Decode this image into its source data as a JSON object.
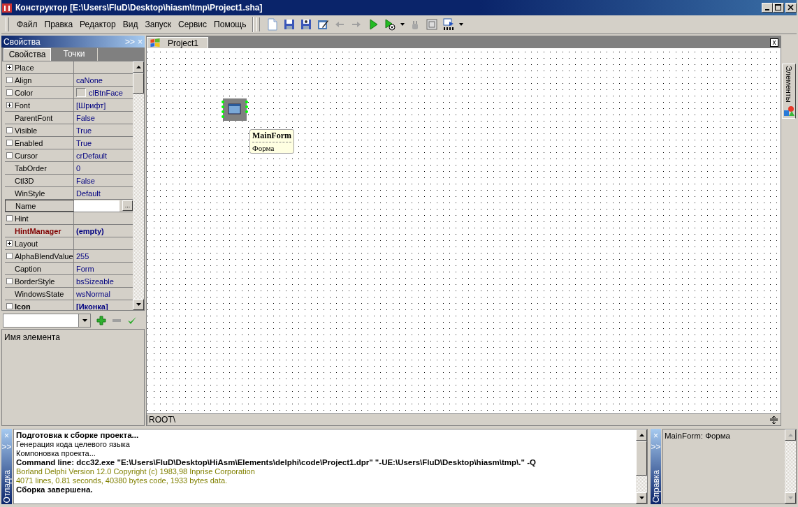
{
  "window": {
    "title": "Конструктор [E:\\Users\\FluD\\Desktop\\hiasm\\tmp\\Project1.sha]"
  },
  "menu": [
    "Файл",
    "Правка",
    "Редактор",
    "Вид",
    "Запуск",
    "Сервис",
    "Помощь"
  ],
  "toolbar": [
    {
      "kind": "new"
    },
    {
      "kind": "save"
    },
    {
      "kind": "saveas"
    },
    {
      "kind": "edit"
    },
    {
      "kind": "back",
      "disabled": true
    },
    {
      "kind": "forward",
      "disabled": true
    },
    {
      "kind": "run",
      "disabled": false
    },
    {
      "kind": "runstop",
      "disabled": false
    },
    {
      "kind": "caret"
    },
    {
      "kind": "plugin",
      "disabled": true
    },
    {
      "kind": "frame"
    },
    {
      "kind": "compile"
    },
    {
      "kind": "caret"
    }
  ],
  "properties_panel": {
    "title": "Свойства",
    "expand": ">>",
    "close": "×",
    "tabs": [
      {
        "label": "Свойства",
        "selected": true
      },
      {
        "label": "Точки",
        "selected": false
      }
    ],
    "rows": [
      {
        "name": "Place",
        "kind": "group",
        "changed": false,
        "selected": false
      },
      {
        "name": "Align",
        "value": "caNone",
        "kind": "check",
        "changed": false,
        "selected": false
      },
      {
        "name": "Color",
        "value": "clBtnFace",
        "kind": "color",
        "changed": false,
        "selected": false
      },
      {
        "name": "Font",
        "value": "[Шрифт]",
        "kind": "group",
        "changed": false,
        "selected": false
      },
      {
        "name": "ParentFont",
        "value": "False",
        "kind": "plain",
        "changed": false,
        "selected": false
      },
      {
        "name": "Visible",
        "value": "True",
        "kind": "check",
        "changed": false,
        "selected": false
      },
      {
        "name": "Enabled",
        "value": "True",
        "kind": "check",
        "changed": false,
        "selected": false
      },
      {
        "name": "Cursor",
        "value": "crDefault",
        "kind": "check",
        "changed": false,
        "selected": false
      },
      {
        "name": "TabOrder",
        "value": "0",
        "kind": "plain",
        "changed": false,
        "selected": false
      },
      {
        "name": "Ctl3D",
        "value": "False",
        "kind": "plain",
        "changed": false,
        "selected": false
      },
      {
        "name": "WinStyle",
        "value": "Default",
        "kind": "plain",
        "changed": false,
        "selected": false
      },
      {
        "name": "Name",
        "kind": "plain",
        "changed": false,
        "selected": true,
        "button": "..."
      },
      {
        "name": "Hint",
        "kind": "check",
        "changed": false,
        "selected": false
      },
      {
        "name": "HintManager",
        "value": "(empty)",
        "kind": "link",
        "changed": true,
        "selected": false
      },
      {
        "name": "Layout",
        "kind": "group",
        "changed": false,
        "selected": false
      },
      {
        "name": "AlphaBlendValue",
        "value": "255",
        "kind": "check",
        "changed": false,
        "selected": false
      },
      {
        "name": "Caption",
        "value": "Form",
        "kind": "plain",
        "changed": false,
        "selected": false
      },
      {
        "name": "BorderStyle",
        "value": "bsSizeable",
        "kind": "check",
        "changed": false,
        "selected": false
      },
      {
        "name": "WindowsState",
        "value": "wsNormal",
        "kind": "plain",
        "changed": false,
        "selected": false
      },
      {
        "name": "Icon",
        "value": "[Иконка]",
        "kind": "check",
        "changed": true,
        "selected": false
      }
    ],
    "description": "Имя элемента"
  },
  "editor": {
    "tab": "Project1",
    "close": "x",
    "path": "ROOT\\",
    "element": {
      "name": "MainForm",
      "description": "Форма"
    }
  },
  "side_tab": "Элементы",
  "debug": {
    "title": "Отладка",
    "close": "×",
    "expand": ">>",
    "lines": [
      {
        "text": "Подготовка к сборке проекта...",
        "kind": "bold"
      },
      {
        "text": "Генерация кода целевого языка",
        "kind": "normal"
      },
      {
        "text": "Компоновка проекта...",
        "kind": "normal"
      },
      {
        "text": "Command line: dcc32.exe \"E:\\Users\\FluD\\Desktop\\HiAsm\\Elements\\delphi\\code\\Project1.dpr\" \"-UE:\\Users\\FluD\\Desktop\\hiasm\\tmp\\.\" -Q",
        "kind": "bold"
      },
      {
        "text": "Borland Delphi  Version 12.0  Copyright (c) 1983,98 Inprise Corporation",
        "kind": "info"
      },
      {
        "text": "4071 lines, 0.81 seconds, 40380 bytes code, 1933 bytes data.",
        "kind": "info"
      },
      {
        "text": "Сборка завершена.",
        "kind": "bold"
      }
    ]
  },
  "help": {
    "title": "Справка",
    "close": "×",
    "expand": ">>",
    "text": "MainForm: Форма"
  }
}
